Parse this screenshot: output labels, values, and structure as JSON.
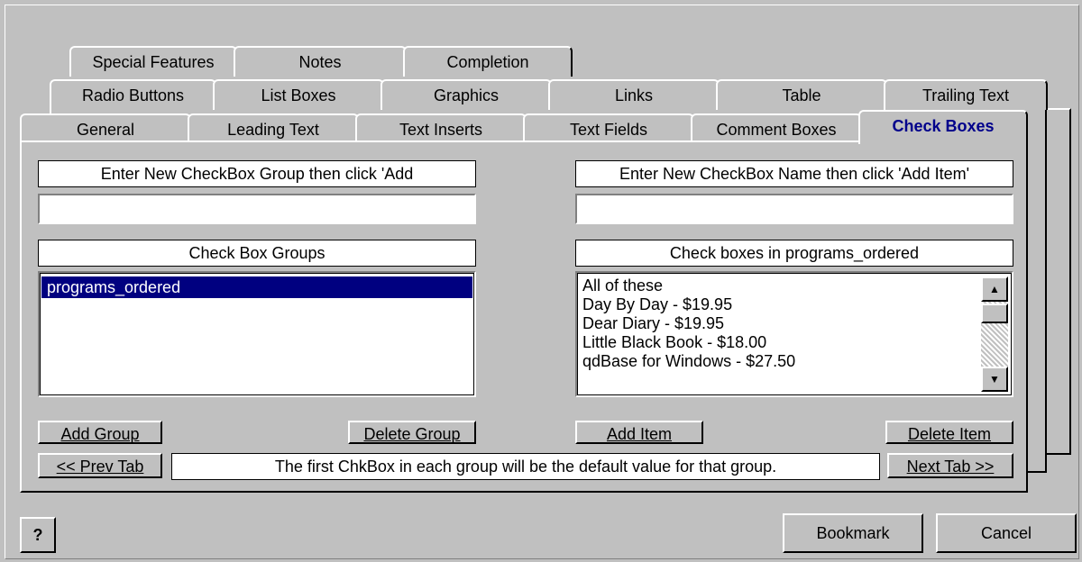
{
  "tabs_row3": [
    "Special Features",
    "Notes",
    "Completion"
  ],
  "tabs_row2": [
    "Radio Buttons",
    "List Boxes",
    "Graphics",
    "Links",
    "Table",
    "Trailing Text"
  ],
  "tabs_row1": [
    "General",
    "Leading Text",
    "Text Inserts",
    "Text Fields",
    "Comment Boxes",
    "Check Boxes"
  ],
  "group_prompt": "Enter New CheckBox Group then click 'Add",
  "group_input_value": "",
  "groups_header": "Check Box Groups",
  "groups": [
    "programs_ordered"
  ],
  "item_prompt": "Enter New CheckBox Name then click 'Add Item'",
  "item_input_value": "",
  "items_header": "Check boxes in programs_ordered",
  "items": [
    "All of these",
    "Day By Day - $19.95",
    "Dear Diary - $19.95",
    "Little Black Book - $18.00",
    "qdBase for Windows - $27.50"
  ],
  "buttons": {
    "add_group": "Add Group",
    "delete_group": "Delete Group",
    "add_item": "Add Item",
    "delete_item": "Delete Item",
    "prev_tab": "<< Prev Tab",
    "next_tab": "Next Tab >>",
    "bookmark": "Bookmark",
    "cancel": "Cancel",
    "help": "?"
  },
  "hint": "The first ChkBox in each group will be the default value for that group.",
  "icons": {
    "help": "help-icon",
    "scroll_up": "scroll-up-arrow-icon",
    "scroll_down": "scroll-down-arrow-icon"
  },
  "colors": {
    "selection": "#000080",
    "active_tab_text": "#00008b",
    "face": "#c0c0c0"
  }
}
